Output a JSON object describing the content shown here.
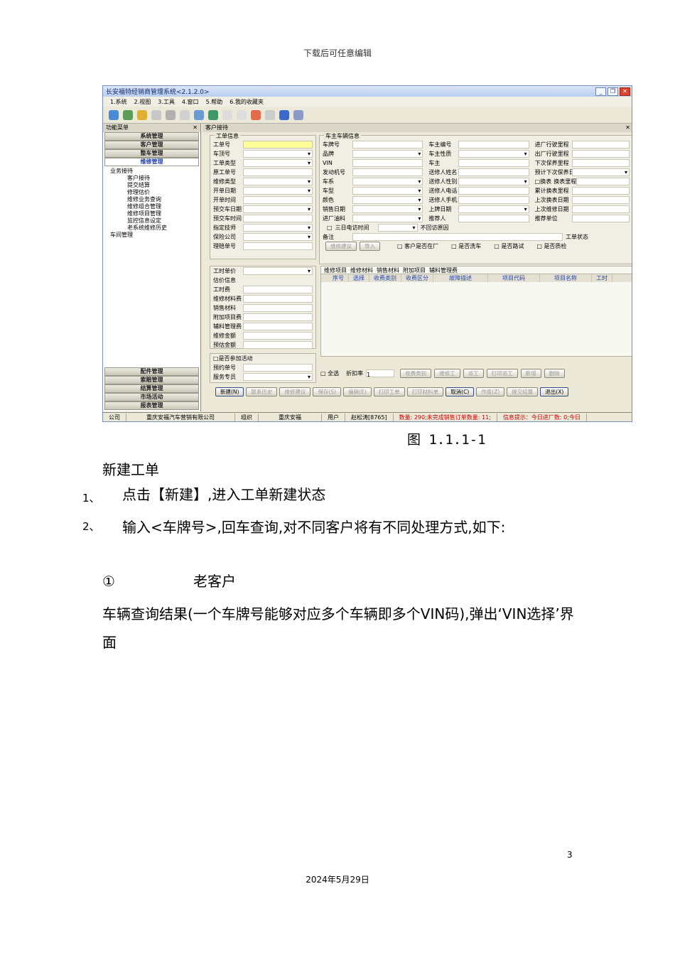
{
  "page_header": "下载后可任意编辑",
  "app": {
    "title": "长安福特经销商管理系统<2.1.2.0>",
    "menu": [
      "1.系统",
      "2.视图",
      "3.工具",
      "4.窗口",
      "5.帮助",
      "6.我的收藏夹"
    ],
    "sidebar": {
      "title": "功能菜单",
      "modules_top": [
        "系统管理",
        "客户管理",
        "整车管理",
        "维修管理"
      ],
      "tree_root": "业务接待",
      "tree_items": [
        "客户接待",
        "提交结算",
        "修理估价",
        "维修业务查询",
        "维修组合管理",
        "维修项目管理",
        "监控信息设定",
        "老系统维修历史"
      ],
      "tree_root2": "车间管理",
      "modules_bottom": [
        "配件管理",
        "索赔管理",
        "结算管理",
        "市场活动",
        "报表管理"
      ]
    },
    "tab": "客户接待",
    "group_work_order": {
      "title": "工单信息",
      "fields": [
        "工单号",
        "车顶号",
        "工单类型",
        "原工单号",
        "维修类型",
        "开单日期",
        "开单时间",
        "预交车日期",
        "预交车时间",
        "指定技师",
        "保险公司",
        "理赔单号"
      ]
    },
    "group_owner": {
      "title": "车主车辆信息",
      "col1": [
        "车牌号",
        "品牌",
        "VIN",
        "发动机号",
        "车系",
        "车型",
        "颜色",
        "销售日期",
        "进厂油料"
      ],
      "col2": [
        "车主编号",
        "车主性质",
        "车主",
        "送修人姓名",
        "送修人性别",
        "送修人电话",
        "送修人手机",
        "上牌日期",
        "推荐人"
      ],
      "col3": [
        "进厂行驶里程",
        "出厂行驶里程",
        "下次保养里程",
        "预计下次保养日期",
        "换表里程",
        "累计换表里程",
        "上次换表日期",
        "上次维修日期",
        "推荐单位"
      ],
      "extra": [
        "三日电访时间",
        "不回访原因",
        "备注",
        "工单状态",
        "换表"
      ]
    },
    "checks": [
      "客户是否在厂",
      "是否洗车",
      "是否路试",
      "是否质检"
    ],
    "small_btns": [
      "维修建议",
      "导入"
    ],
    "estimate": {
      "labor_price": "工时单价",
      "title": "估价信息",
      "fields": [
        "工时费",
        "维修材料费",
        "销售材料",
        "附加项目费",
        "辅料管理费",
        "维修金额",
        "预估金额"
      ]
    },
    "activity": {
      "check": "是否参加活动",
      "fields": [
        "预约单号",
        "服务专员"
      ]
    },
    "grid": {
      "tabs": [
        "维修项目",
        "维修材料",
        "销售材料",
        "附加项目",
        "辅料管理费"
      ],
      "cols": [
        "序号",
        "选择",
        "收费类别",
        "收费区分",
        "故障描述",
        "项目代码",
        "项目名称",
        "工时"
      ]
    },
    "grid_bar": {
      "all": "全选",
      "discount": "折扣率",
      "discount_val": "1",
      "btns": [
        "收费类别",
        "维修工",
        "派工",
        "打印派工",
        "新增",
        "删除"
      ]
    },
    "bottom_btns": [
      "新建(N)",
      "联系历史",
      "维修建议",
      "保存(S)",
      "编辑(E)",
      "打印工单",
      "打印材料单",
      "取消(C)",
      "作废(Z)",
      "提交结算",
      "退出(X)"
    ],
    "status": [
      "公司",
      "重庆安福汽车营销有限公司",
      "组织",
      "重庆安福",
      "用户",
      "赵松涛[8765]",
      "数量: 290;未完成销售订单数量: 11;",
      "信息提示：今日进厂数: 0;今日"
    ]
  },
  "caption": "图 1.1.1-1",
  "heading": "新建工单",
  "steps": [
    {
      "num": "1、",
      "text": "点击【新建】,进入工单新建状态"
    },
    {
      "num": "2、",
      "text": "输入<车牌号>,回车查询,对不同客户将有不同处理方式,如下:"
    }
  ],
  "sub_item": {
    "mark": "①",
    "text": "老客户"
  },
  "para": "车辆查询结果(一个车牌号能够对应多个车辆即多个VIN码),弹出‘VIN选择’界面",
  "page_number": "3",
  "date": "2024年5月29日"
}
